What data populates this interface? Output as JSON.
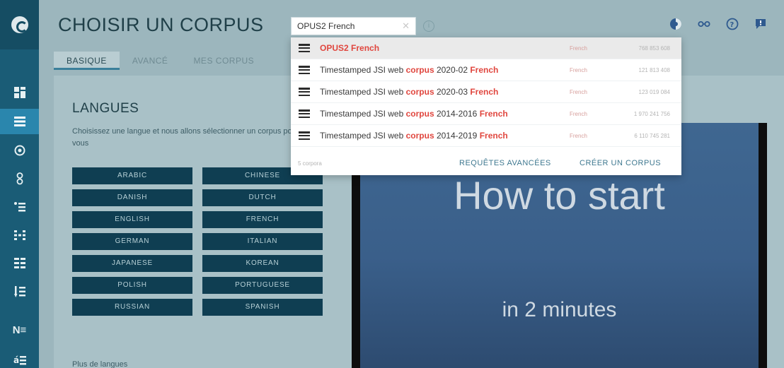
{
  "header": {
    "title": "CHOISIR UN CORPUS",
    "tabs": [
      {
        "label": "BASIQUE"
      },
      {
        "label": "AVANCÉ"
      },
      {
        "label": "MES CORPUS"
      }
    ]
  },
  "search": {
    "value": "OPUS2 French",
    "clear_symbol": "✕",
    "info_symbol": "i"
  },
  "top_icons": [
    "theme-icon",
    "glasses-icon",
    "help-icon",
    "feedback-icon"
  ],
  "sidebar": {
    "items": [
      {
        "icon": "dashboard-icon",
        "active": false
      },
      {
        "icon": "list-icon",
        "active": true
      },
      {
        "icon": "target-icon",
        "active": false
      },
      {
        "icon": "key-icon",
        "active": false
      },
      {
        "icon": "bullet-list-icon",
        "active": false
      },
      {
        "icon": "ngram-icon",
        "active": false
      },
      {
        "icon": "grid-icon",
        "active": false
      },
      {
        "icon": "sort-icon",
        "active": false
      },
      {
        "icon": "ne-icon",
        "active": false,
        "text": "N≡"
      },
      {
        "icon": "ae-icon",
        "active": false
      }
    ]
  },
  "languages": {
    "title": "LANGUES",
    "description": "Choisissez une langue et nous allons sélectionner un corpus pour vous",
    "buttons": [
      "ARABIC",
      "CHINESE",
      "DANISH",
      "DUTCH",
      "ENGLISH",
      "FRENCH",
      "GERMAN",
      "ITALIAN",
      "JAPANESE",
      "KOREAN",
      "POLISH",
      "PORTUGUESE",
      "RUSSIAN",
      "SPANISH"
    ],
    "more": "Plus de langues"
  },
  "video": {
    "line1": "How to start",
    "line2": "in 2 minutes"
  },
  "dropdown": {
    "results": [
      {
        "before": "",
        "hit1": "OPUS2 French",
        "middle": "",
        "hit2": "",
        "lang": "French",
        "size": "768 853 608",
        "highlight": true
      },
      {
        "before": "Timestamped JSI web ",
        "hit1": "corpus",
        "middle": " 2020-02 ",
        "hit2": "French",
        "lang": "French",
        "size": "121 813 408",
        "highlight": false
      },
      {
        "before": "Timestamped JSI web ",
        "hit1": "corpus",
        "middle": " 2020-03 ",
        "hit2": "French",
        "lang": "French",
        "size": "123 019 084",
        "highlight": false
      },
      {
        "before": "Timestamped JSI web ",
        "hit1": "corpus",
        "middle": " 2014-2016 ",
        "hit2": "French",
        "lang": "French",
        "size": "1 970 241 756",
        "highlight": false
      },
      {
        "before": "Timestamped JSI web ",
        "hit1": "corpus",
        "middle": " 2014-2019 ",
        "hit2": "French",
        "lang": "French",
        "size": "6 110 745 281",
        "highlight": false
      }
    ],
    "count": "5 corpora",
    "advanced_link": "REQUÊTES AVANCÉES",
    "create_link": "CRÉER UN CORPUS"
  }
}
